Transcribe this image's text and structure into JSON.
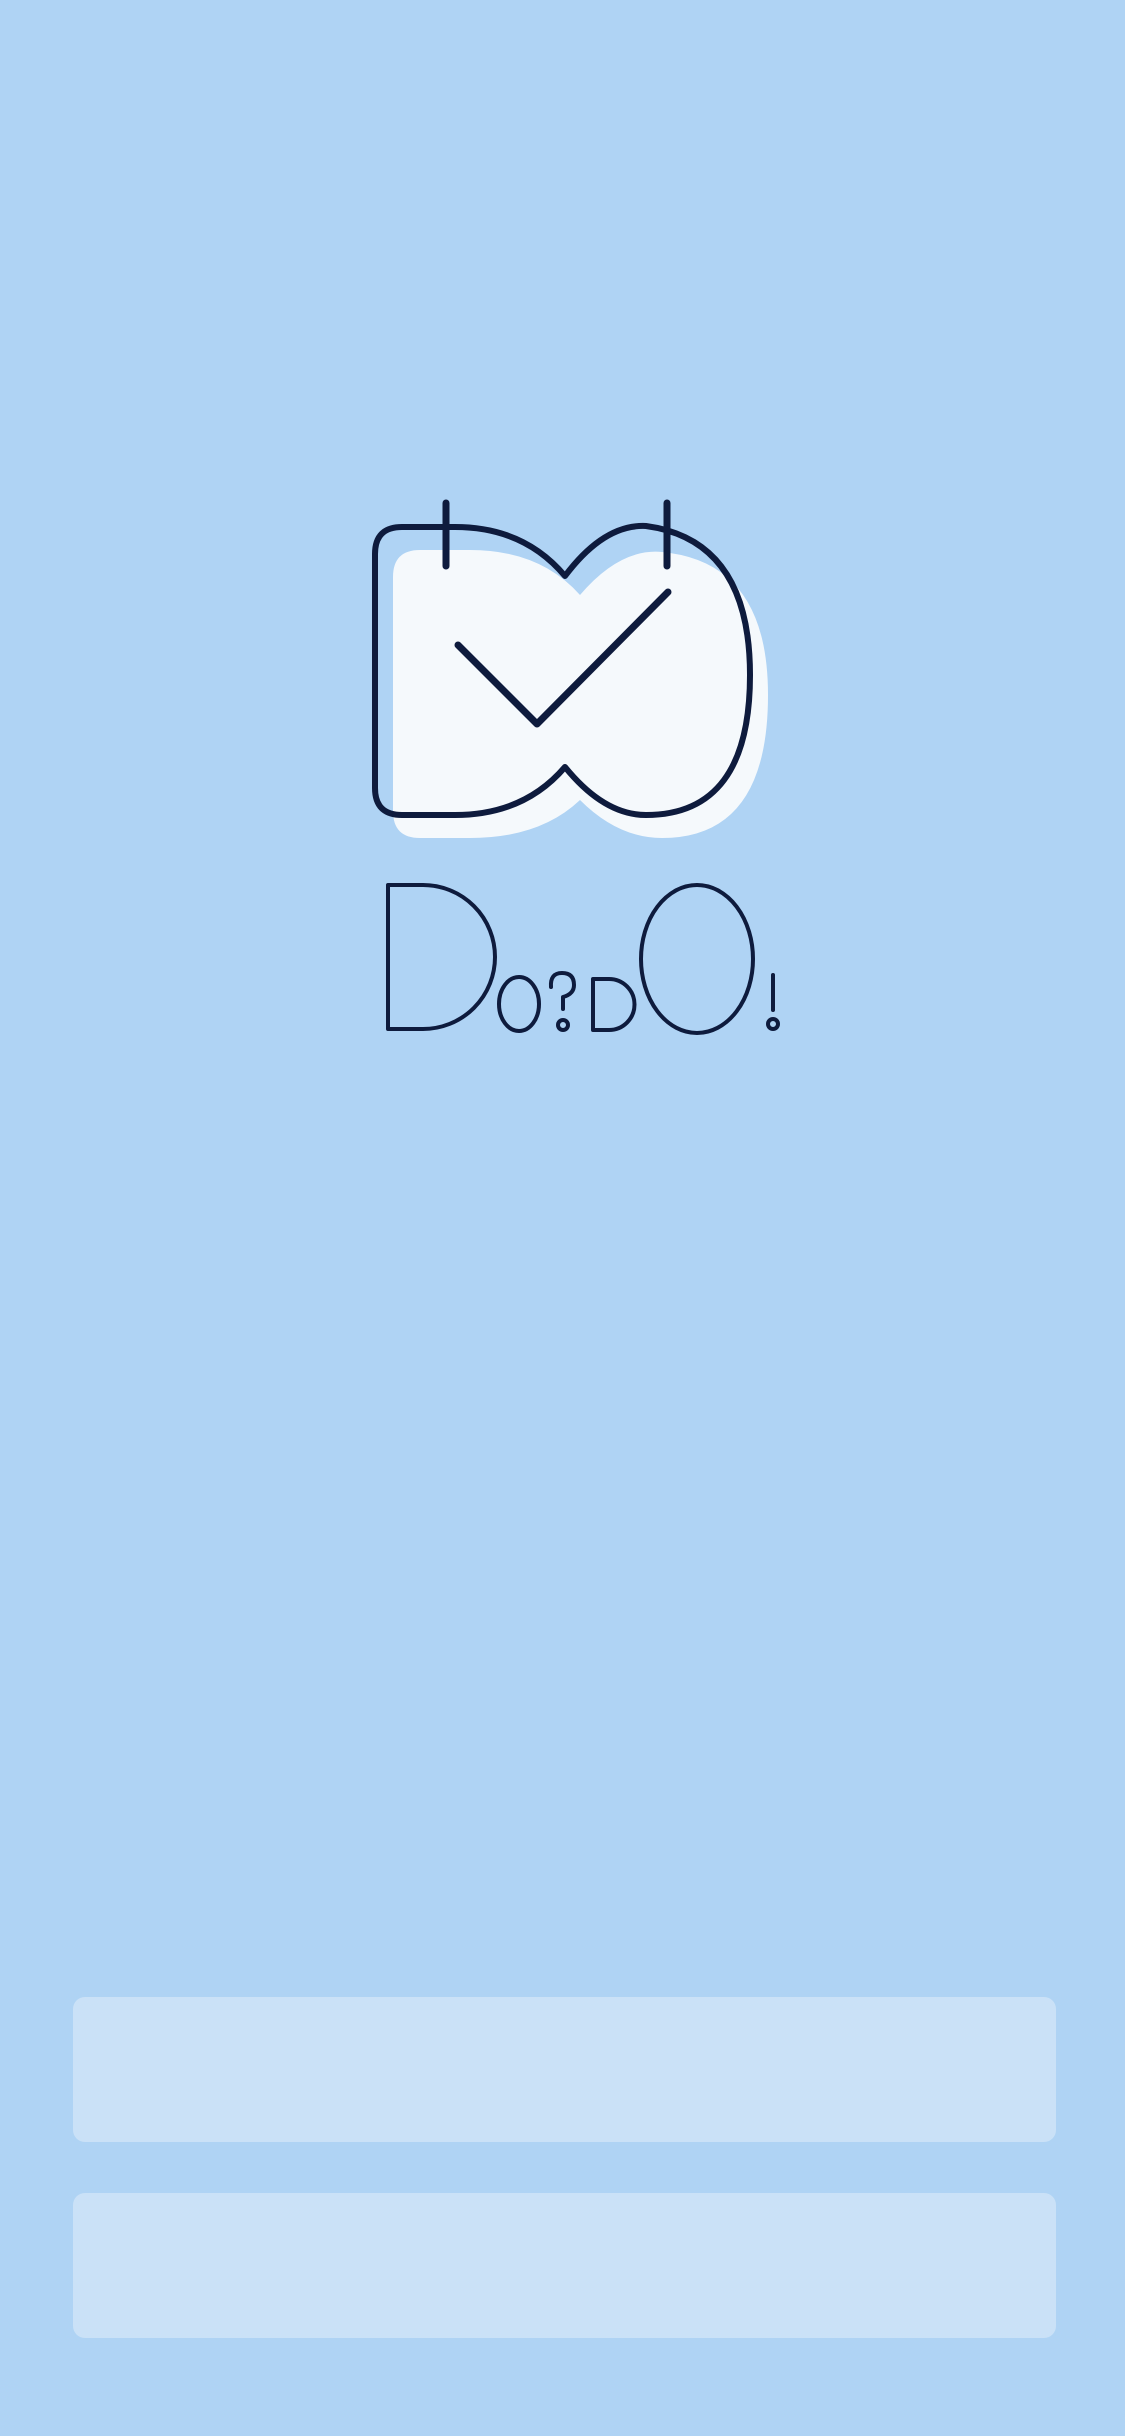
{
  "app": {
    "name": "DO?DO!",
    "logo_icon": "calendar-check-icon"
  },
  "colors": {
    "background": "#AFD3F4",
    "ink": "#0E1B3D",
    "logo_fill": "#F5F9FC",
    "button_fill": "#CAE1F7"
  },
  "actions": {
    "primary_label": "",
    "secondary_label": ""
  }
}
